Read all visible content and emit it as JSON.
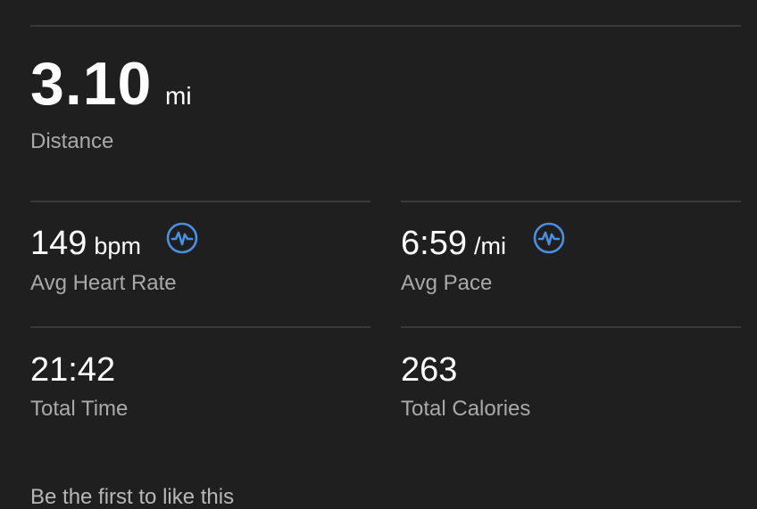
{
  "distance": {
    "value": "3.10",
    "unit": "mi",
    "label": "Distance"
  },
  "avg_heart_rate": {
    "value": "149",
    "unit": "bpm",
    "label": "Avg Heart Rate",
    "icon": "heart-rate-chart-icon"
  },
  "avg_pace": {
    "value": "6:59",
    "unit": "/mi",
    "label": "Avg Pace",
    "icon": "heart-rate-chart-icon"
  },
  "total_time": {
    "value": "21:42",
    "label": "Total Time"
  },
  "total_calories": {
    "value": "263",
    "label": "Total Calories"
  },
  "social": {
    "like_prompt": "Be the first to like this"
  },
  "colors": {
    "background": "#1f1f1f",
    "divider": "#3a3a3a",
    "label": "#a9a9a9",
    "accent": "#4a90e2"
  }
}
